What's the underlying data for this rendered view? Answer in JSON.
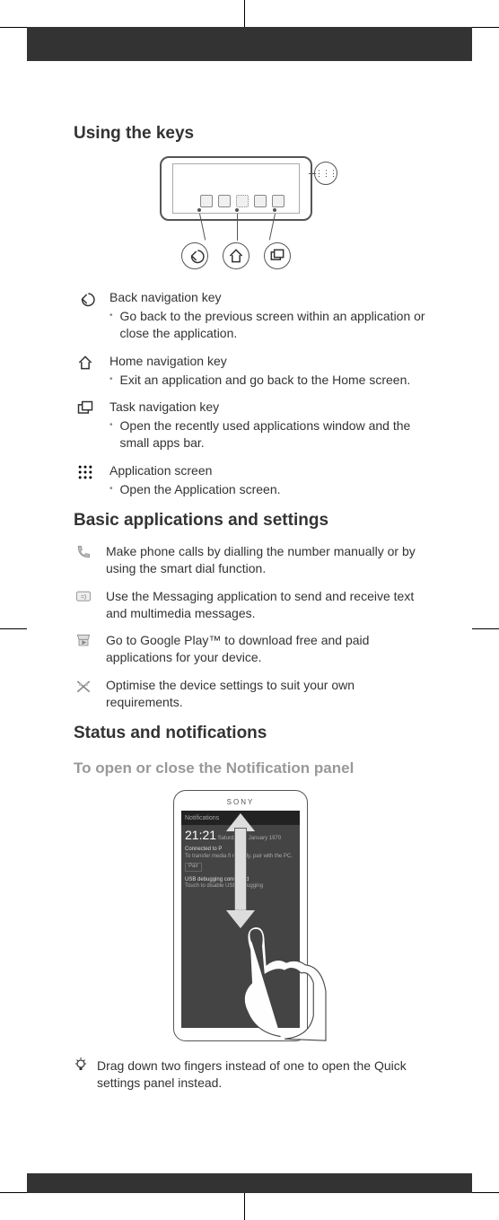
{
  "sections": {
    "keys_heading": "Using the keys",
    "basic_heading": "Basic applications and settings",
    "status_heading": "Status and notifications",
    "notif_sub": "To open or close the Notification panel"
  },
  "keys": {
    "back": {
      "title": "Back navigation key",
      "desc": "Go back to the previous screen within an application or close the application."
    },
    "home": {
      "title": "Home navigation key",
      "desc": "Exit an application and go back to the Home screen."
    },
    "task": {
      "title": "Task navigation key",
      "desc": "Open the recently used applications window and the small apps bar."
    },
    "apps": {
      "title": "Application screen",
      "desc": "Open the Application screen."
    }
  },
  "bullet": "•",
  "apps_list": {
    "phone": "Make phone calls by dialling the number manually or by using the smart dial function.",
    "msg": "Use the Messaging application to send and receive text and multimedia messages.",
    "play": "Go to Google Play™ to download free and paid applications for your device.",
    "settings": "Optimise the device settings to suit your own requirements."
  },
  "phone2": {
    "brand": "SONY",
    "notif_label": "Notifications",
    "time": "21:21",
    "date_small": "Saturday 31 January 1970",
    "connect_title": "Connected to P",
    "connect_sub": "To transfer media fi relessly, pair with the PC.",
    "pair": "Pair",
    "usb_title": "USB debugging connected",
    "usb_sub": "Touch to disable USB debugging"
  },
  "tip": "Drag down two fingers instead of one to open the Quick settings panel instead."
}
